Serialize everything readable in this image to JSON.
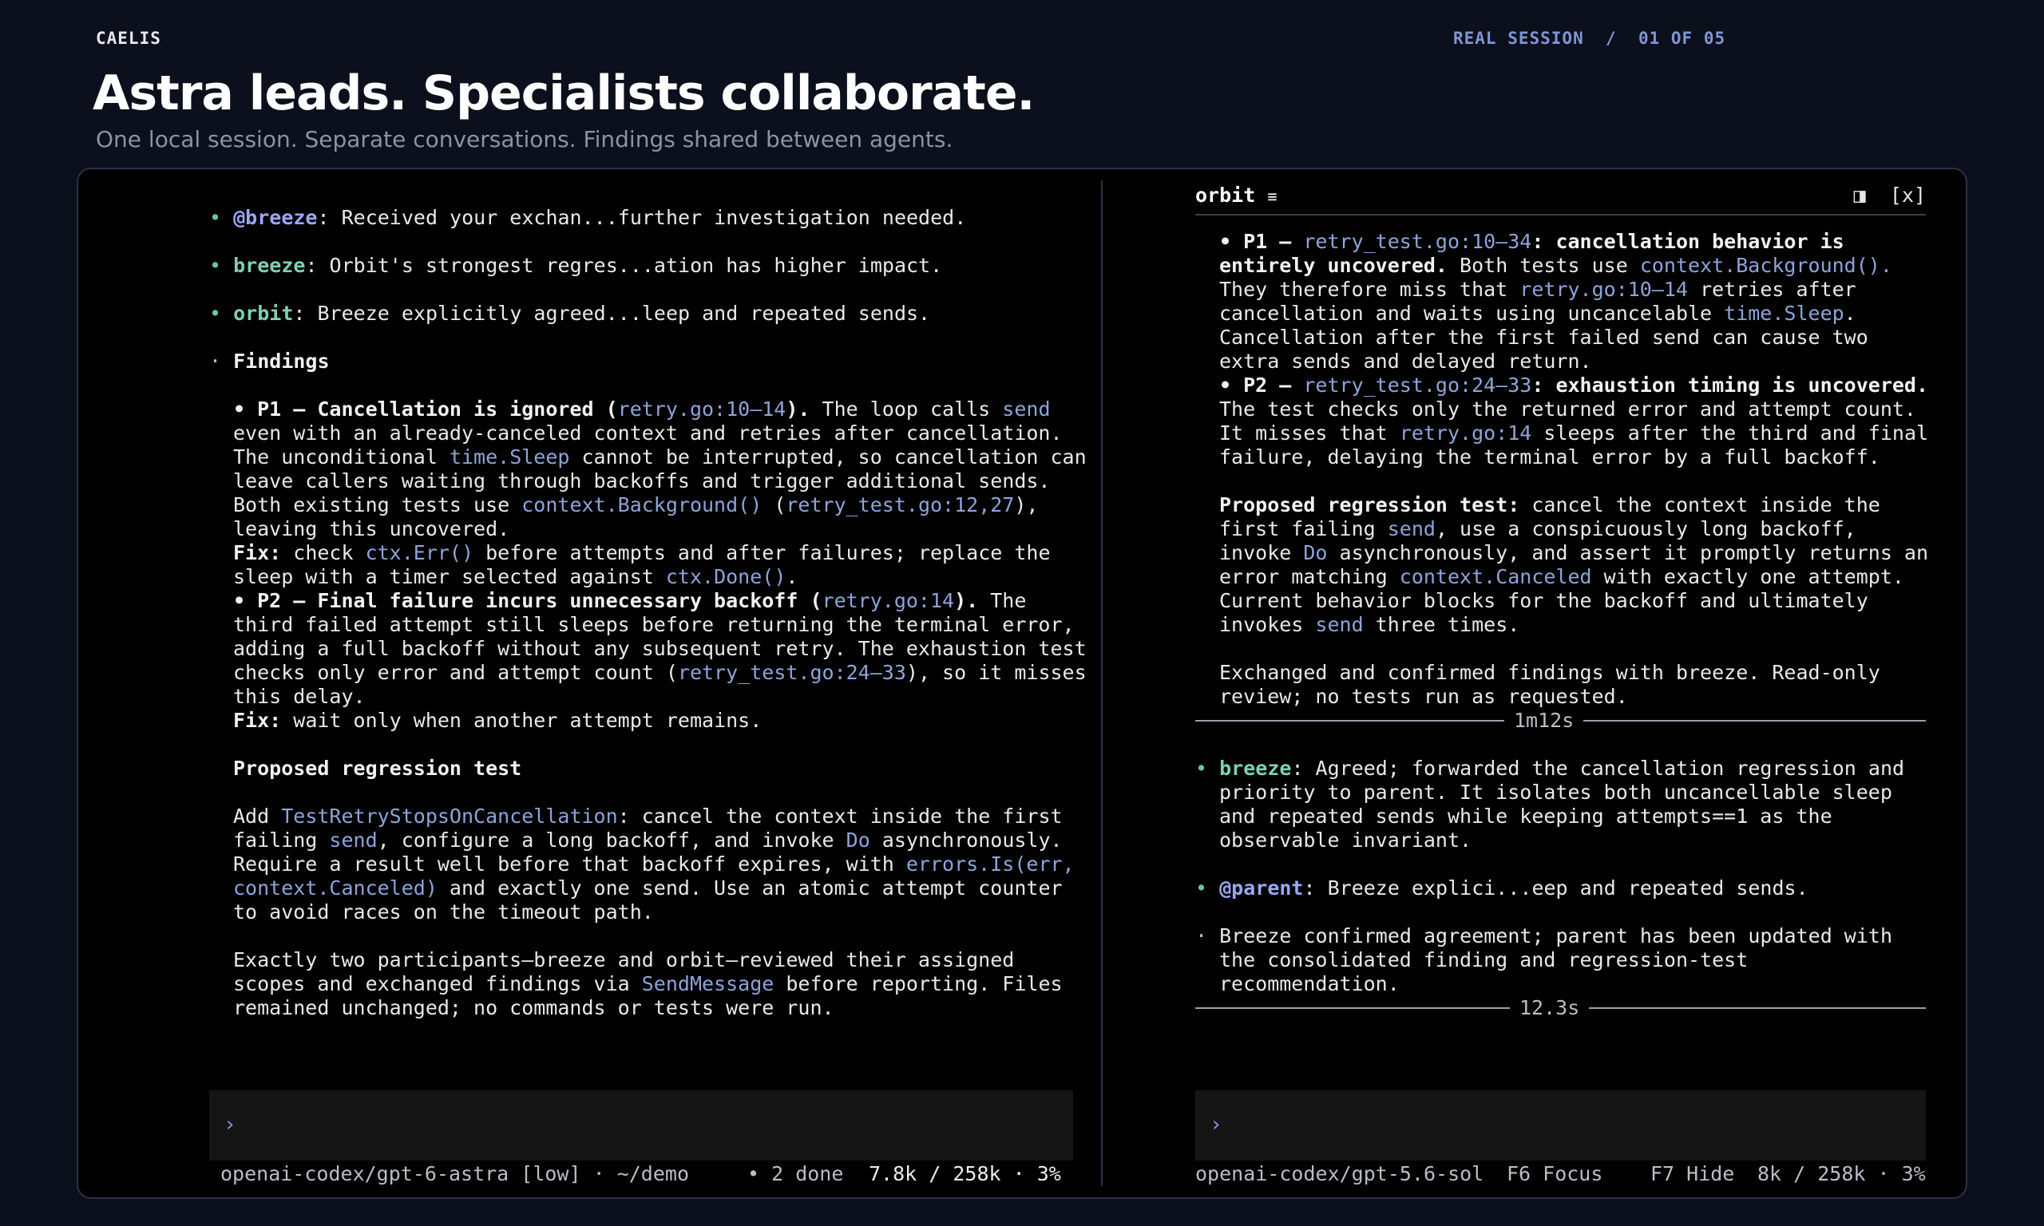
{
  "header": {
    "brand": "CAELIS",
    "session_label": "REAL SESSION",
    "separator": "/",
    "counter": "01 OF 05",
    "title": "Astra leads. Specialists collaborate.",
    "subtitle": "One local session. Separate conversations. Findings shared between agents."
  },
  "left_pane": {
    "messages": [
      {
        "bullet": "•",
        "sender": "@breeze",
        "text": ": Received your exchan...further investigation needed."
      },
      {
        "bullet": "•",
        "sender": "breeze",
        "text": ": Orbit's strongest regres...ation has higher impact."
      },
      {
        "bullet": "•",
        "sender": "orbit",
        "text": ": Breeze explicitly agreed...leep and repeated sends."
      }
    ],
    "findings_bullet": "·",
    "findings_heading": "Findings",
    "p1": {
      "title": "• P1 — Cancellation is ignored (",
      "ref": "retry.go:10–14",
      "title_end": ").",
      "l1a": " The loop calls ",
      "l1code": "send",
      "l2": "even with an already-canceled context and retries after cancellation.",
      "l3a": "The unconditional ",
      "l3code": "time.Sleep",
      "l3b": " cannot be interrupted, so cancellation can",
      "l4": "leave callers waiting through backoffs and trigger additional sends.",
      "l5a": "Both existing tests use ",
      "l5code": "context.Background()",
      "l5b": " (",
      "l5ref": "retry_test.go:12,27",
      "l5c": "),",
      "l6": "leaving this uncovered.",
      "fix_label": "Fix:",
      "fix_a": " check ",
      "fix_code1": "ctx.Err()",
      "fix_b": " before attempts and after failures; replace the",
      "fix2a": "sleep with a timer selected against ",
      "fix2code": "ctx.Done()",
      "fix2b": "."
    },
    "p2": {
      "title": "• P2 — Final failure incurs unnecessary backoff (",
      "ref": "retry.go:14",
      "title_end": ").",
      "l1b": " The",
      "l2": "third failed attempt still sleeps before returning the terminal error,",
      "l3": "adding a full backoff without any subsequent retry. The exhaustion test",
      "l4a": "checks only error and attempt count (",
      "l4ref": "retry_test.go:24–33",
      "l4b": "), so it misses",
      "l5": "this delay.",
      "fix_label": "Fix:",
      "fix": " wait only when another attempt remains."
    },
    "regression_heading": "Proposed regression test",
    "regression": {
      "l1a": "Add ",
      "l1code": "TestRetryStopsOnCancellation",
      "l1b": ": cancel the context inside the first",
      "l2a": "failing ",
      "l2code1": "send",
      "l2b": ", configure a long backoff, and invoke ",
      "l2code2": "Do",
      "l2c": " asynchronously.",
      "l3a": "Require a result well before that backoff expires, with ",
      "l3code": "errors.Is(err,",
      "l4code": "context.Canceled)",
      "l4b": " and exactly one send. Use an atomic attempt counter",
      "l5": "to avoid races on the timeout path."
    },
    "summary": {
      "l1": "Exactly two participants—breeze and orbit—reviewed their assigned",
      "l2a": "scopes and exchanged findings via ",
      "l2code": "SendMessage",
      "l2b": " before reporting. Files",
      "l3": "remained unchanged; no commands or tests were run."
    },
    "prompt_symbol": "›",
    "status": {
      "model": "openai-codex/gpt-6-astra [low] · ~/demo",
      "done": "• 2 done",
      "tokens": "7.8k / 258k · 3%"
    }
  },
  "right_pane": {
    "title": "orbit",
    "title_icon": "≡",
    "split_icon": "◨",
    "close_label": "[x]",
    "p1": {
      "a": "• P1 — ",
      "ref": "retry_test.go:10–34",
      "b": ": cancellation behavior is",
      "l2b": "entirely uncovered.",
      "l2a": " Both tests use ",
      "l2code": "context.Background().",
      "l3a": "They therefore miss that ",
      "l3ref": "retry.go:10–14",
      "l3b": " retries after",
      "l4a": "cancellation and waits using uncancelable ",
      "l4code": "time.Sleep",
      "l4b": ".",
      "l5": "Cancellation after the first failed send can cause two",
      "l6": "extra sends and delayed return."
    },
    "p2": {
      "a": "• P2 — ",
      "ref": "retry_test.go:24–33",
      "b": ": exhaustion timing is uncovered.",
      "l2": "The test checks only the returned error and attempt count.",
      "l3a": "It misses that ",
      "l3ref": "retry.go:14",
      "l3b": " sleeps after the third and final",
      "l4": "failure, delaying the terminal error by a full backoff."
    },
    "regression": {
      "label": "Proposed regression test:",
      "l1": " cancel the context inside the",
      "l2a": "first failing ",
      "l2code": "send",
      "l2b": ", use a conspicuously long backoff,",
      "l3a": "invoke ",
      "l3code": "Do",
      "l3b": " asynchronously, and assert it promptly returns an",
      "l4a": "error matching ",
      "l4code": "context.Canceled",
      "l4b": " with exactly one attempt.",
      "l5": "Current behavior blocks for the backoff and ultimately",
      "l6a": "invokes ",
      "l6code": "send",
      "l6b": " three times."
    },
    "exchange": {
      "l1": "Exchanged and confirmed findings with breeze. Read-only",
      "l2": "review; no tests run as requested."
    },
    "rule1": "1m12s",
    "breeze_msg": {
      "bullet": "•",
      "sender": "breeze",
      "l1": ": Agreed; forwarded the cancellation regression and",
      "l2": "priority to parent. It isolates both uncancellable sleep",
      "l3": "and repeated sends while keeping attempts==1 as the",
      "l4": "observable invariant."
    },
    "parent_msg": {
      "bullet": "•",
      "sender": "@parent",
      "text": ": Breeze explici...eep and repeated sends."
    },
    "confirm": {
      "bullet": "·",
      "l1": "Breeze confirmed agreement; parent has been updated with",
      "l2": "the consolidated finding and regression-test",
      "l3": "recommendation."
    },
    "rule2": "12.3s",
    "prompt_symbol": "›",
    "status": {
      "model": "openai-codex/gpt-5.6-sol",
      "focus": "F6 Focus",
      "hide": "F7 Hide",
      "tokens": "8k / 258k · 3%"
    }
  }
}
